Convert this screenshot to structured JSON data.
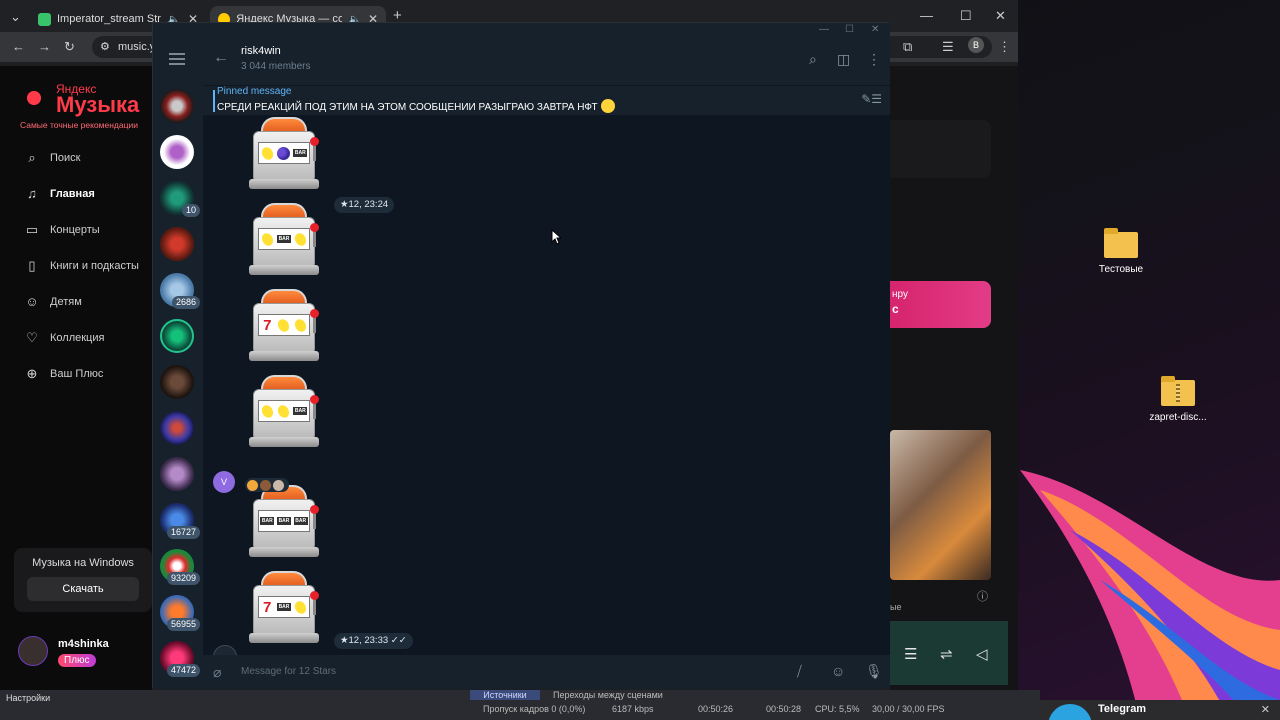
{
  "browser": {
    "tabs": [
      {
        "label": "Imperator_stream Stream",
        "favicon_color": "#37c46b"
      },
      {
        "label": "Яндекс Музыка — собира",
        "favicon_color": "#ffcc00"
      }
    ],
    "new_tab_icon": "plus-icon",
    "url_text": "music.y",
    "profile_letter": "B"
  },
  "yandex_music": {
    "logo_top": "Яндекс",
    "logo_main": "Музыка",
    "tagline": "Самые точные рекомендации",
    "nav": [
      {
        "label": "Поиск",
        "icon": "search-icon"
      },
      {
        "label": "Главная",
        "icon": "music-note-icon"
      },
      {
        "label": "Концерты",
        "icon": "ticket-icon"
      },
      {
        "label": "Книги и подкасты",
        "icon": "book-icon"
      },
      {
        "label": "Детям",
        "icon": "kids-icon"
      },
      {
        "label": "Коллекция",
        "icon": "heart-icon"
      },
      {
        "label": "Ваш Плюс",
        "icon": "plus-circle-icon"
      }
    ],
    "windows_card_text": "Музыка на Windows",
    "download_label": "Скачать",
    "user_name": "m4shinka",
    "plus_badge": "Плюс",
    "banner_line1": "нру",
    "banner_line2": "с",
    "cover_caption": "ые",
    "brand_color": "#ff3b4a"
  },
  "desktop": {
    "icons": [
      {
        "label": "Тестовые"
      },
      {
        "label": "zapret-disc..."
      }
    ]
  },
  "telegram": {
    "chat_name": "risk4win",
    "members": "3 044 members",
    "pinned_label": "Pinned message",
    "pinned_text": "СРЕДИ РЕАКЦИЙ ПОД ЭТИМ НА ЭТОМ СООБЩЕНИИ РАЗЫГРАЮ ЗАВТРА НФТ",
    "chats_badges": [
      "10",
      "2686",
      "16727",
      "93209",
      "56955",
      "47472"
    ],
    "slot_messages": [
      {
        "reels": [
          "lemon",
          "grape",
          "bar"
        ],
        "time": ""
      },
      {
        "reels": [
          "lemon",
          "bar",
          "lemon"
        ],
        "time": "12, 23:24"
      },
      {
        "reels": [
          "seven",
          "lemon",
          "lemon"
        ],
        "time": ""
      },
      {
        "reels": [
          "lemon",
          "lemon",
          "bar"
        ],
        "time": ""
      },
      {
        "reels": [
          "bar",
          "bar",
          "bar"
        ],
        "time": ""
      },
      {
        "reels": [
          "seven",
          "bar",
          "lemon"
        ],
        "time": "12, 23:33"
      }
    ],
    "sender_initial": "V",
    "compose_placeholder": "Message for 12 Stars",
    "accent_color": "#5eb5f7"
  },
  "obs": {
    "tab_sources": "Источники",
    "tab_transitions": "Переходы между сценами",
    "settings_label": "Настройки",
    "dropped_frames": "Пропуск кадров 0 (0,0%)",
    "bitrate": "6187 kbps",
    "stream_time": "00:50:26",
    "rec_time": "00:50:28",
    "cpu": "CPU: 5,5%",
    "fps": "30,00 / 30,00 FPS"
  },
  "notification": {
    "title": "Telegram"
  }
}
